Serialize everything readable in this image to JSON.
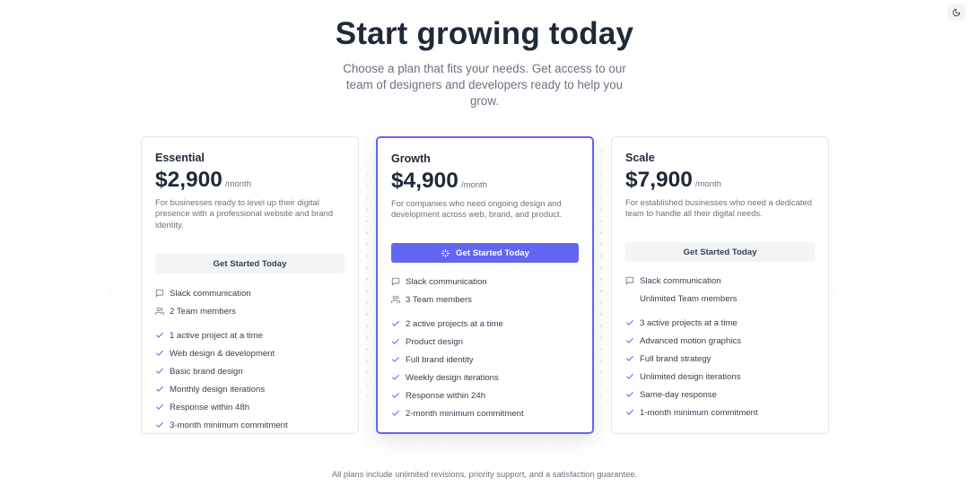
{
  "header": {
    "title": "Start growing today",
    "subtitle": "Choose a plan that fits your needs. Get access to our team of designers and developers ready to help you grow."
  },
  "theme_toggle": {
    "icon": "moon-icon"
  },
  "colors": {
    "accent": "#6366f1",
    "text": "#1f2937",
    "muted": "#6b7280",
    "border": "#e5e7eb"
  },
  "plans": [
    {
      "name": "Essential",
      "price": "$2,900",
      "period": "/month",
      "description": "For businesses ready to level up their digital presence with a professional website and brand identity.",
      "cta": "Get Started Today",
      "communication": [
        "Slack communication",
        "2 Team members"
      ],
      "features": [
        "1 active project at a time",
        "Web design & development",
        "Basic brand design",
        "Monthly design iterations",
        "Response within 48h",
        "3-month minimum commitment"
      ]
    },
    {
      "name": "Growth",
      "price": "$4,900",
      "period": "/month",
      "description": "For companies who need ongoing design and development across web, brand, and product.",
      "cta": "Get Started Today",
      "communication": [
        "Slack communication",
        "3 Team members"
      ],
      "features": [
        "2 active projects at a time",
        "Product design",
        "Full brand identity",
        "Weekly design iterations",
        "Response within 24h",
        "2-month minimum commitment"
      ]
    },
    {
      "name": "Scale",
      "price": "$7,900",
      "period": "/month",
      "description": "For established businesses who need a dedicated team to handle all their digital needs.",
      "cta": "Get Started Today",
      "communication": [
        "Slack communication",
        "Unlimited Team members"
      ],
      "features": [
        "3 active projects at a time",
        "Advanced motion graphics",
        "Full brand strategy",
        "Unlimited design iterations",
        "Same-day response",
        "1-month minimum commitment"
      ]
    }
  ],
  "footer": {
    "note": "All plans include unlimited revisions, priority support, and a satisfaction guarantee."
  }
}
